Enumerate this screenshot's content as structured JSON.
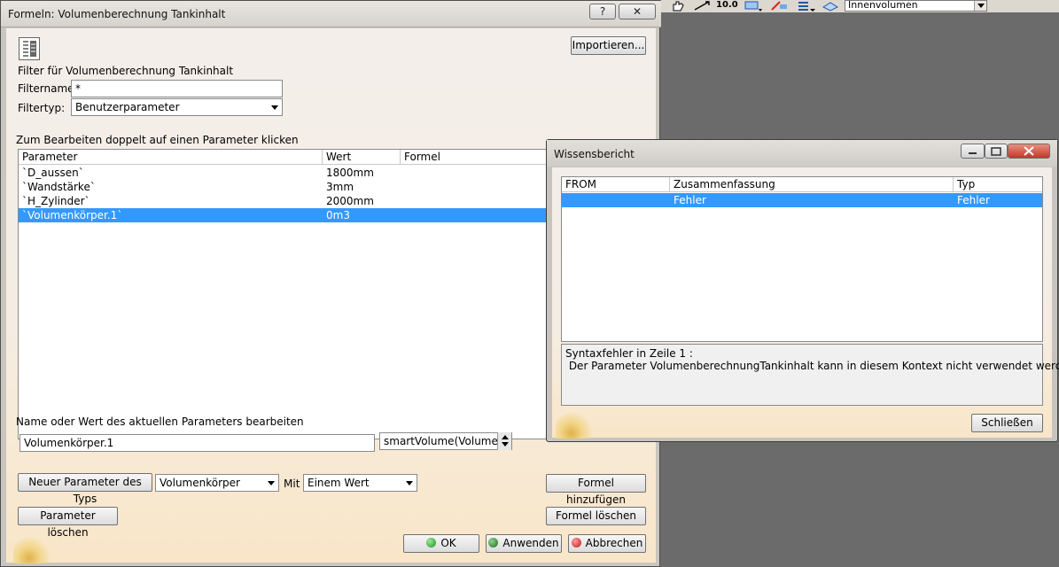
{
  "toolbar_top": {
    "numeric_label": "10.0",
    "combo_value": "Innenvolumen"
  },
  "main_dialog": {
    "title": "Formeln: Volumenberechnung Tankinhalt",
    "help_button": "?",
    "close_button": "✕",
    "import_button": "Importieren...",
    "filter_heading": "Filter für Volumenberechnung Tankinhalt",
    "filtername_label": "Filtername:",
    "filtername_value": "*",
    "filtertyp_label": "Filtertyp:",
    "filtertyp_value": "Benutzerparameter",
    "edit_hint": "Zum Bearbeiten doppelt auf einen Parameter klicken",
    "table": {
      "columns": [
        "Parameter",
        "Wert",
        "Formel"
      ],
      "rows": [
        {
          "parameter": "`D_aussen`",
          "wert": "1800mm",
          "formel": ""
        },
        {
          "parameter": "`Wandstärke`",
          "wert": "3mm",
          "formel": ""
        },
        {
          "parameter": "`H_Zylinder`",
          "wert": "2000mm",
          "formel": ""
        },
        {
          "parameter": "`Volumenkörper.1`",
          "wert": "0m3",
          "formel": "",
          "selected": true
        }
      ]
    },
    "edit_label": "Name oder Wert des aktuellen Parameters bearbeiten",
    "param_name_value": "Volumenkörper.1",
    "param_formula_value": "smartVolume(Volumenb",
    "new_param_button": "Neuer Parameter des Typs",
    "new_param_type": "Volumenkörper",
    "mit_label": "Mit",
    "mit_value": "Einem Wert",
    "add_formula_button": "Formel hinzufügen",
    "delete_param_button": "Parameter löschen",
    "delete_formula_button": "Formel löschen",
    "ok_button": "OK",
    "apply_button": "Anwenden",
    "cancel_button": "Abbrechen"
  },
  "knowledge_report": {
    "title": "Wissensbericht",
    "columns": [
      "FROM",
      "Zusammenfassung",
      "Typ"
    ],
    "rows": [
      {
        "from": "",
        "summary": "Fehler",
        "type": "Fehler",
        "selected": true
      }
    ],
    "message_line1": "Syntaxfehler in Zeile 1 :",
    "message_line2": " Der Parameter VolumenberechnungTankinhalt kann in diesem Kontext nicht verwendet werden.",
    "close_button": "Schließen"
  },
  "colors": {
    "selection": "#3399ff",
    "ok_dot": "#2fa12f",
    "apply_dot": "#2f7d2f",
    "cancel_dot": "#d02020"
  }
}
